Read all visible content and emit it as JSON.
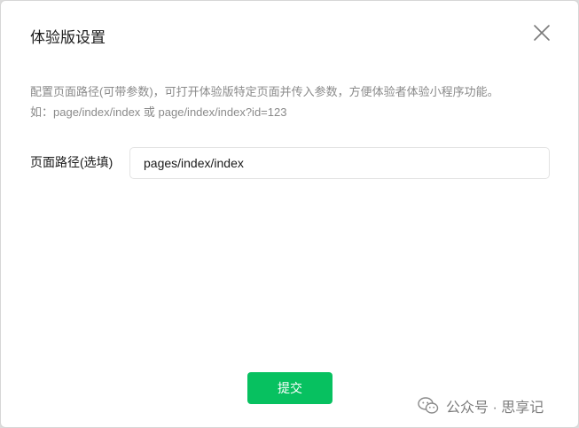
{
  "dialog": {
    "title": "体验版设置",
    "description_line1": "配置页面路径(可带参数)，可打开体验版特定页面并传入参数，方便体验者体验小程序功能。",
    "description_line2": "如：page/index/index 或 page/index/index?id=123",
    "field_label": "页面路径(选填)",
    "path_value": "pages/index/index",
    "submit_label": "提交"
  },
  "watermark": {
    "text": "公众号 · 思享记"
  },
  "colors": {
    "primary": "#07c160",
    "text": "#1a1a1a",
    "muted": "#8a8a8a"
  },
  "icons": {
    "close": "close-icon",
    "watermark": "wechat-logo-icon"
  }
}
